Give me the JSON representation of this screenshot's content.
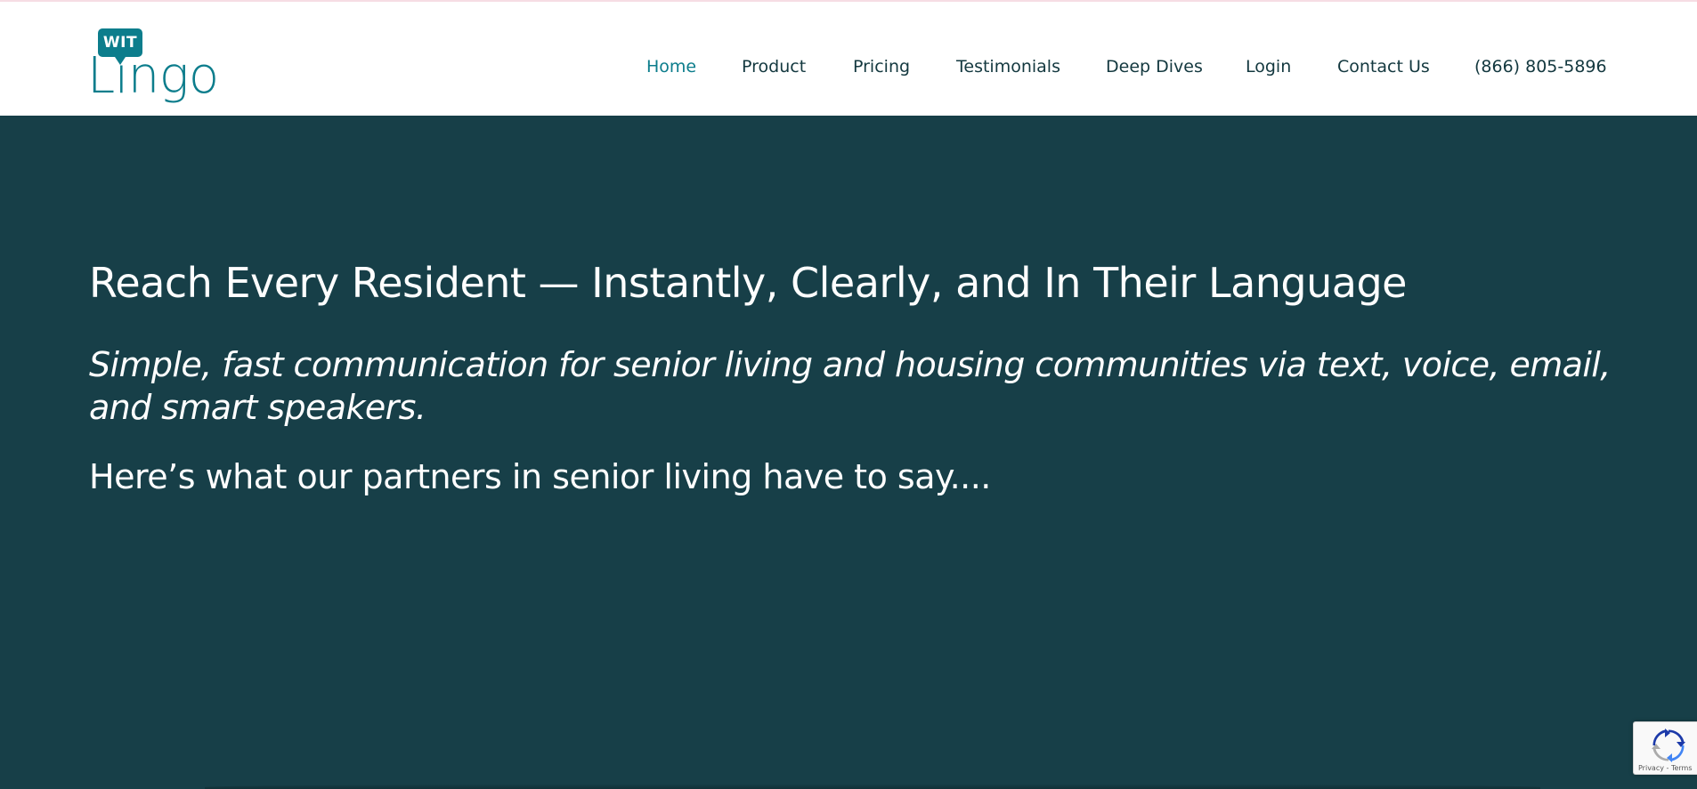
{
  "logo": {
    "badge": "WIT",
    "word": "Lingo"
  },
  "nav": {
    "items": [
      {
        "label": "Home",
        "active": true
      },
      {
        "label": "Product"
      },
      {
        "label": "Pricing"
      },
      {
        "label": "Testimonials"
      },
      {
        "label": "Deep Dives"
      },
      {
        "label": "Login"
      },
      {
        "label": "Contact Us"
      },
      {
        "label": "(866) 805-5896"
      }
    ]
  },
  "hero": {
    "title": "Reach Every Resident — Instantly, Clearly, and In Their Language",
    "subtitle": "Simple, fast communication for senior living and housing communities via text, voice, email, and smart speakers.",
    "partners": "Here’s what our partners in senior living have to say...."
  },
  "recaptcha": {
    "privacy": "Privacy",
    "separator": " - ",
    "terms": "Terms"
  },
  "colors": {
    "accent": "#0c7d8c",
    "hero_bg": "#173f48",
    "nav_text": "#13383f"
  }
}
